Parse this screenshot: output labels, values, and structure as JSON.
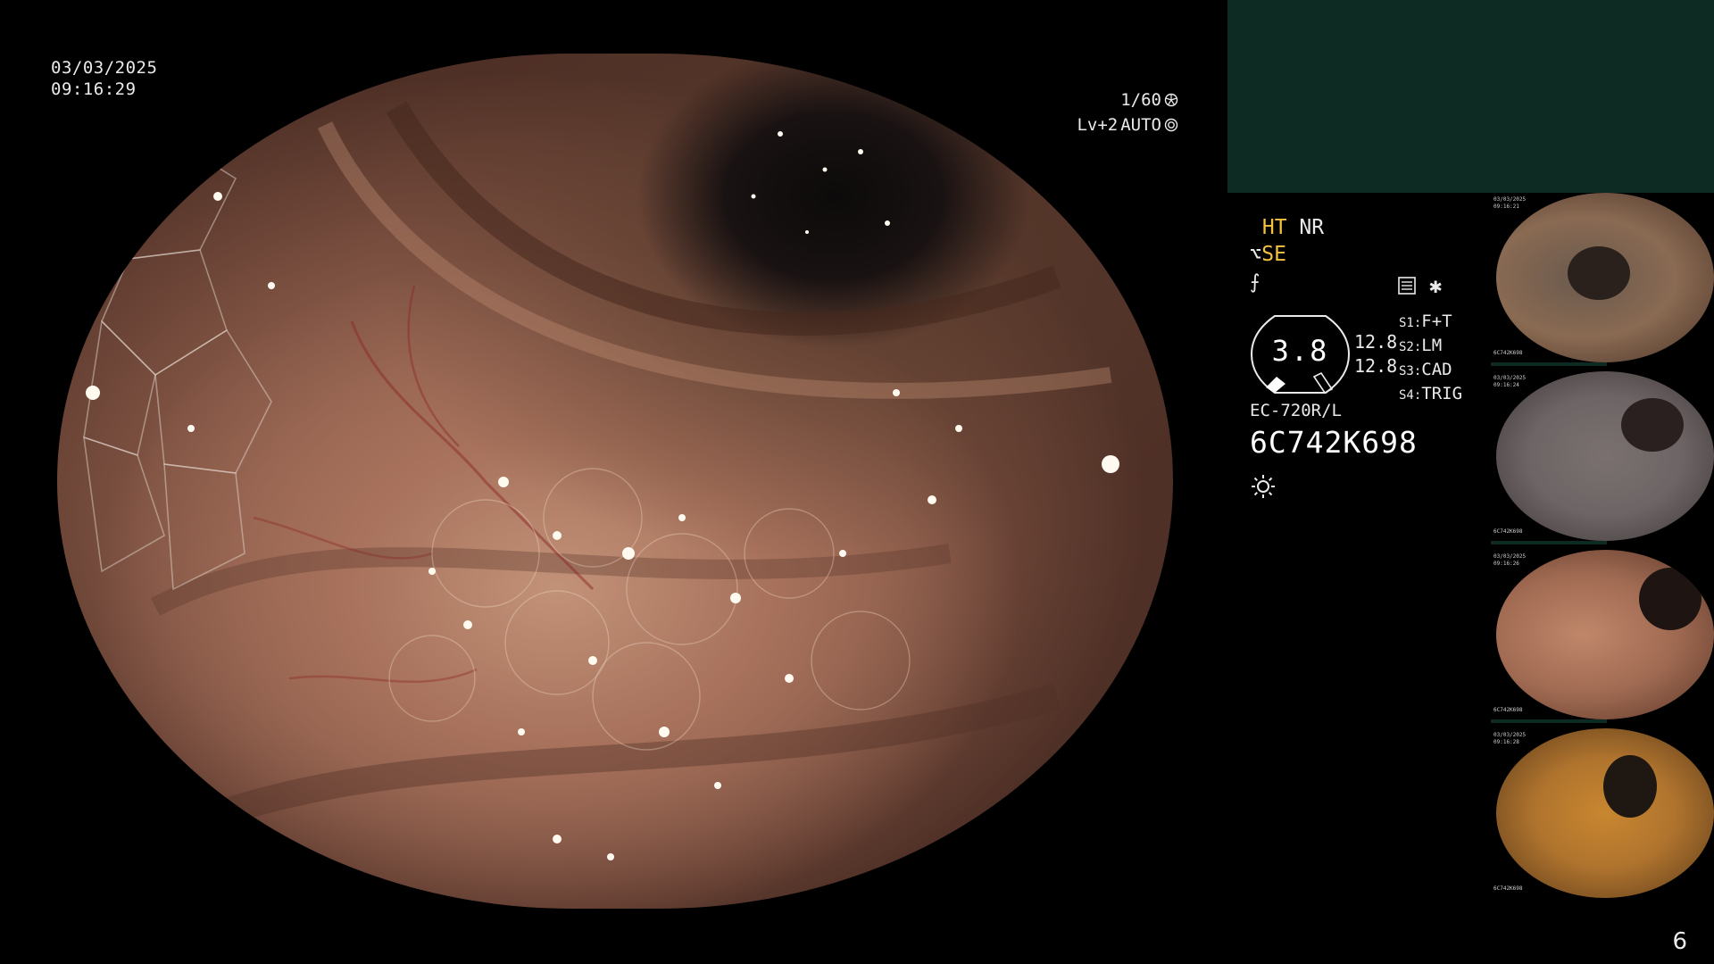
{
  "datetime": {
    "date": "03/03/2025",
    "time": "09:16:29"
  },
  "camera": {
    "shutter": "1/60",
    "brightness": "Lv+2",
    "iris": "AUTO"
  },
  "status": {
    "ht": "HT",
    "nr": "NR",
    "se": "SE",
    "se_symbol": "⌥",
    "mode_symbol": "⨍"
  },
  "aux": {
    "doc_icon": "document-icon",
    "star": "✱"
  },
  "gauge": {
    "value": "3.8",
    "reading1": "12.8",
    "reading2": "12.8"
  },
  "scope_settings": [
    {
      "key": "S1:",
      "value": "F+T"
    },
    {
      "key": "S2:",
      "value": "LM"
    },
    {
      "key": "S3:",
      "value": "CAD"
    },
    {
      "key": "S4:",
      "value": "TRIG"
    }
  ],
  "scope_model": "EC-720R/L",
  "scope_serial": "6C742K698",
  "light_icon": "sun-icon",
  "thumbnails": [
    {
      "date": "03/03/2025",
      "time": "09:16:21",
      "serial": "6C742K698",
      "tone": "#8a6a52"
    },
    {
      "date": "03/03/2025",
      "time": "09:16:24",
      "serial": "6C742K698",
      "tone": "#6d6565"
    },
    {
      "date": "03/03/2025",
      "time": "09:16:26",
      "serial": "6C742K698",
      "tone": "#a06a52"
    },
    {
      "date": "03/03/2025",
      "time": "09:16:28",
      "serial": "6C742K698",
      "tone": "#b0742e"
    }
  ],
  "page_number": "6",
  "colors": {
    "accent_yellow": "#f6c23e",
    "panel_green": "#0d2a23"
  }
}
